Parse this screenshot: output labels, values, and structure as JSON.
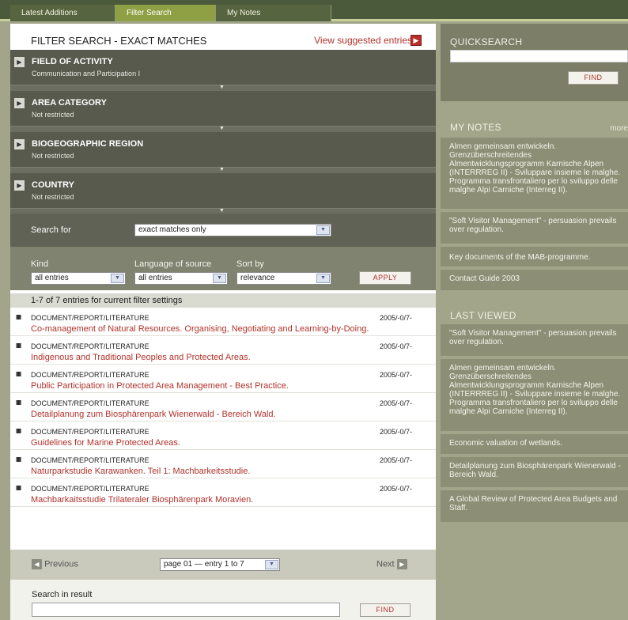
{
  "tabs": [
    {
      "label": "Latest Additions"
    },
    {
      "label": "Filter Search"
    },
    {
      "label": "My Notes"
    }
  ],
  "header": {
    "title": "FILTER SEARCH - EXACT MATCHES",
    "suggested_link": "View suggested entries"
  },
  "facets": [
    {
      "title": "FIELD OF ACTIVITY",
      "value": "Communication and Participation I"
    },
    {
      "title": "AREA CATEGORY",
      "value": "Not restricted"
    },
    {
      "title": "BIOGEOGRAPHIC REGION",
      "value": "Not restricted"
    },
    {
      "title": "COUNTRY",
      "value": "Not restricted"
    }
  ],
  "search_for": {
    "label": "Search for",
    "selected": "exact matches only"
  },
  "filters": {
    "kind_label": "Kind",
    "kind_value": "all entries",
    "language_label": "Language of source",
    "language_value": "all entries",
    "sort_label": "Sort by",
    "sort_value": "relevance",
    "apply_label": "APPLY"
  },
  "results_count": "1-7 of 7 entries for current filter settings",
  "results": [
    {
      "relevance": "IIIII",
      "type": "DOCUMENT/REPORT/LITERATURE",
      "date": "2005/-0/7-",
      "title": "Co-management of Natural Resources. Organising, Negotiating and Learning-by-Doing."
    },
    {
      "relevance": "IIIII",
      "type": "DOCUMENT/REPORT/LITERATURE",
      "date": "2005/-0/7-",
      "title": "Indigenous and Traditional Peoples and Protected Areas."
    },
    {
      "relevance": "IIIII",
      "type": "DOCUMENT/REPORT/LITERATURE",
      "date": "2005/-0/7-",
      "title": "Public Participation in Protected Area Management - Best Practice."
    },
    {
      "relevance": "IIIII",
      "type": "DOCUMENT/REPORT/LITERATURE",
      "date": "2005/-0/7-",
      "title": "Detailplanung zum Biosphärenpark Wienerwald - Bereich Wald."
    },
    {
      "relevance": "IIIII",
      "type": "DOCUMENT/REPORT/LITERATURE",
      "date": "2005/-0/7-",
      "title": "Guidelines for Marine Protected Areas."
    },
    {
      "relevance": "IIIII",
      "type": "DOCUMENT/REPORT/LITERATURE",
      "date": "2005/-0/7-",
      "title": "Naturparkstudie Karawanken. Teil 1: Machbarkeitsstudie."
    },
    {
      "relevance": "IIIII",
      "type": "DOCUMENT/REPORT/LITERATURE",
      "date": "2005/-0/7-",
      "title": "Machbarkaitsstudie Trilateraler Biosphärenpark Moravien."
    }
  ],
  "pager": {
    "previous": "Previous",
    "next": "Next",
    "page_select": "page 01 — entry 1 to 7"
  },
  "search_in_result": {
    "label": "Search in result",
    "find_label": "FIND"
  },
  "quicksearch": {
    "title": "QUICKSEARCH",
    "find_label": "FIND"
  },
  "my_notes": {
    "title": "MY NOTES",
    "more": "more",
    "items": [
      "Almen gemeinsam entwickeln. Grenzüberschreitendes Almentwicklungsprogramm Karnische Alpen (INTERRREG II) - Sviluppare insieme le malghe. Programma transfrontaliero per lo sviluppo delle malghe Alpi Carniche (Interreg II).",
      "\"Soft Visitor Management\" - persuasion prevails over regulation.",
      "Key documents of the MAB-programme.",
      "Contact Guide 2003"
    ]
  },
  "last_viewed": {
    "title": "LAST VIEWED",
    "items": [
      "\"Soft Visitor Management\" - persuasion prevails over regulation.",
      "Almen gemeinsam entwickeln. Grenzüberschreitendes Almentwicklungsprogramm Karnische Alpen (INTERRREG II) - Sviluppare insieme le malghe. Programma transfrontaliero per lo sviluppo delle malghe Alpi Carniche (Interreg II).",
      "Economic valuation of wetlands.",
      "Detailplanung zum Biosphärenpark Wienerwald - Bereich Wald.",
      "A Global Review of Protected Area Budgets and Staff."
    ]
  }
}
